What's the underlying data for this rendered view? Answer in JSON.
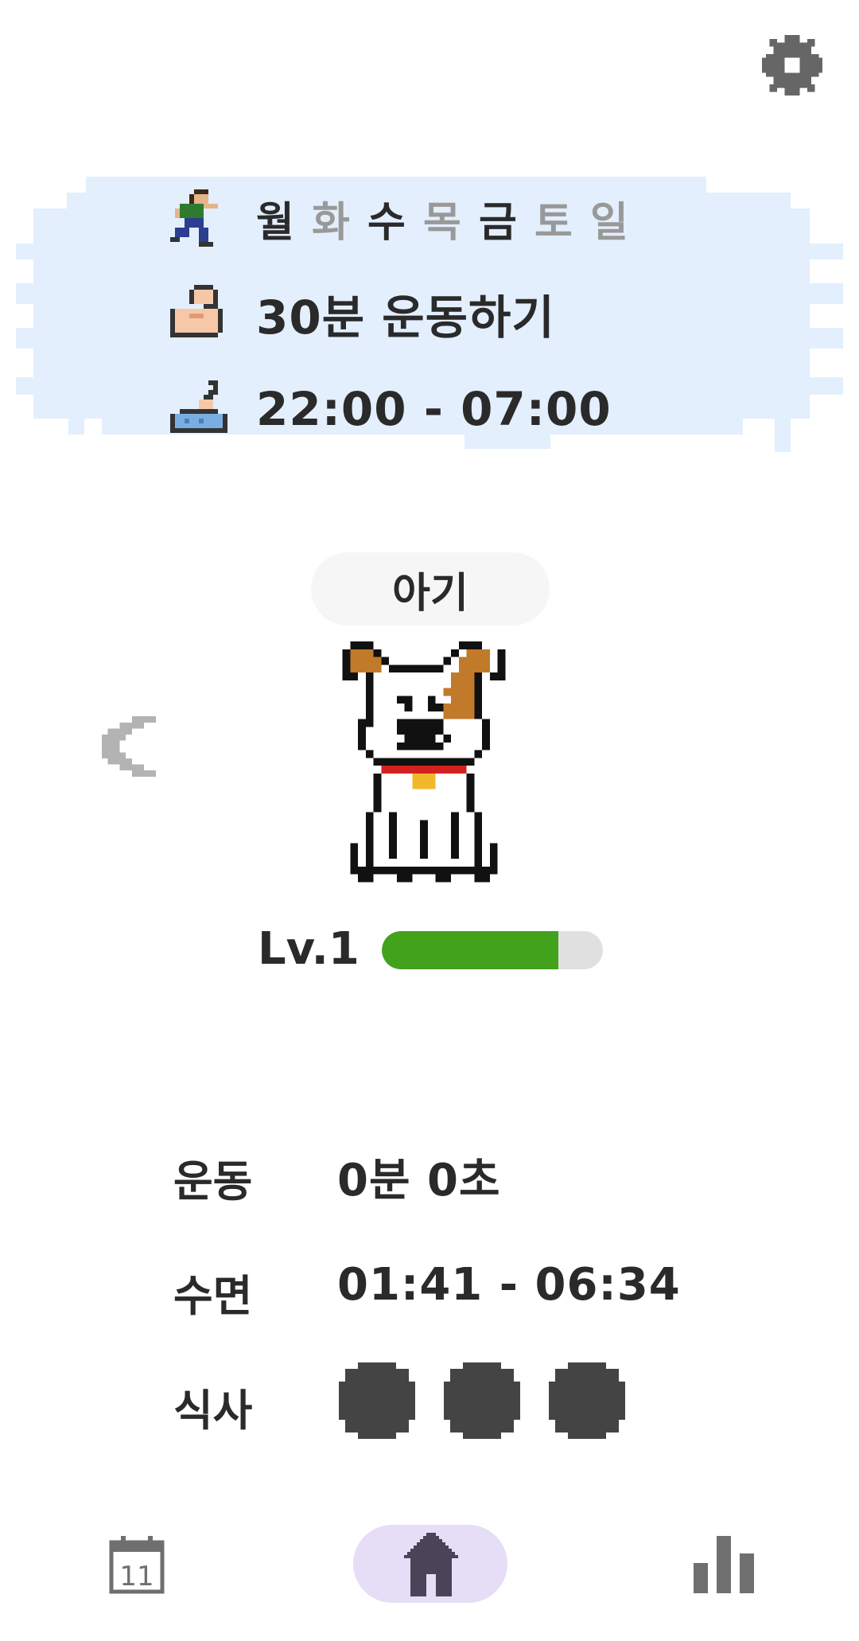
{
  "goals": {
    "days": [
      {
        "label": "월",
        "active": true
      },
      {
        "label": "화",
        "active": false
      },
      {
        "label": "수",
        "active": true
      },
      {
        "label": "목",
        "active": false
      },
      {
        "label": "금",
        "active": true
      },
      {
        "label": "토",
        "active": false
      },
      {
        "label": "일",
        "active": false
      }
    ],
    "exercise_goal": "30분 운동하기",
    "sleep_goal": "22:00 - 07:00",
    "icons": [
      "runner-icon",
      "muscle-icon",
      "sleeping-icon"
    ]
  },
  "pet": {
    "stage": "아기",
    "level": "Lv.1",
    "xp_fraction": 0.8
  },
  "stats": {
    "exercise_label": "운동",
    "exercise_value": "0분 0초",
    "sleep_label": "수면",
    "sleep_value": "01:41 - 06:34",
    "meal_label": "식사",
    "meals_count": 3
  },
  "colors": {
    "card_bg": "#e3effd",
    "xp_fill": "#43a21b",
    "xp_track": "#e0e0e0",
    "nav_active_bg": "#e6def6",
    "meal_dot": "#444444"
  },
  "nav": {
    "calendar_day": "11",
    "items": [
      "calendar-icon",
      "home-icon",
      "stats-icon"
    ]
  }
}
